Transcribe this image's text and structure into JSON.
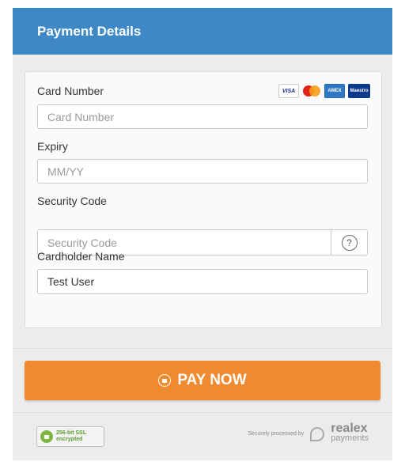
{
  "header": {
    "title": "Payment Details"
  },
  "form": {
    "card_number": {
      "label": "Card Number",
      "placeholder": "Card Number"
    },
    "expiry": {
      "label": "Expiry",
      "placeholder": "MM/YY"
    },
    "security_code": {
      "label": "Security Code",
      "placeholder": "Security Code",
      "help": "?"
    },
    "cardholder": {
      "label": "Cardholder Name",
      "value": "Test User"
    }
  },
  "card_logos": [
    {
      "name": "visa",
      "text": "VISA"
    },
    {
      "name": "mastercard",
      "text": ""
    },
    {
      "name": "amex",
      "text": "AMEX"
    },
    {
      "name": "maestro",
      "text": "Maestro"
    }
  ],
  "pay_button": {
    "label": "PAY NOW"
  },
  "footer": {
    "ssl_line1": "256-bit SSL",
    "ssl_line2": "encrypted",
    "secured_text": "Securely processed by",
    "brand_name": "realex",
    "brand_sub": "payments"
  },
  "colors": {
    "header": "#3e88c6",
    "pay_button": "#ef8a30"
  }
}
